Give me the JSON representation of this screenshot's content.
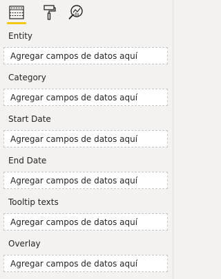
{
  "toolbar": {
    "tabs": [
      {
        "icon": "fields-icon",
        "active": true
      },
      {
        "icon": "format-paint-roller-icon",
        "active": false
      },
      {
        "icon": "analytics-magnifier-icon",
        "active": false
      }
    ],
    "accent_color": "#f2c811"
  },
  "wells": [
    {
      "label": "Entity",
      "placeholder": "Agregar campos de datos aquí"
    },
    {
      "label": "Category",
      "placeholder": "Agregar campos de datos aquí"
    },
    {
      "label": "Start Date",
      "placeholder": "Agregar campos de datos aquí"
    },
    {
      "label": "End Date",
      "placeholder": "Agregar campos de datos aquí"
    },
    {
      "label": "Tooltip texts",
      "placeholder": "Agregar campos de datos aquí"
    },
    {
      "label": "Overlay",
      "placeholder": "Agregar campos de datos aquí"
    }
  ]
}
